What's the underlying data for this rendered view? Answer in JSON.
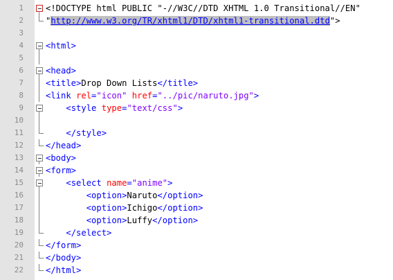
{
  "lines": [
    {
      "n": "1",
      "code": [
        {
          "c": "dt",
          "s": "<!DOCTYPE html PUBLIC \"-//W3C//DTD XHTML 1.0 Transitional//EN\""
        }
      ]
    },
    {
      "n": "2",
      "code": [
        {
          "c": "dt",
          "s": "\""
        },
        {
          "c": "url sel",
          "s": "http://www.w3.org/TR/xhtml1/DTD/xhtml1-transitional.dtd"
        },
        {
          "c": "dt",
          "s": "\">"
        }
      ]
    },
    {
      "n": "3",
      "code": []
    },
    {
      "n": "4",
      "code": [
        {
          "c": "t",
          "s": "<html>"
        }
      ]
    },
    {
      "n": "5",
      "code": []
    },
    {
      "n": "6",
      "code": [
        {
          "c": "t",
          "s": "<head>"
        }
      ]
    },
    {
      "n": "7",
      "code": [
        {
          "c": "t",
          "s": "<title>"
        },
        {
          "c": "x",
          "s": "Drop Down Lists"
        },
        {
          "c": "t",
          "s": "</title>"
        }
      ]
    },
    {
      "n": "8",
      "code": [
        {
          "c": "t",
          "s": "<link "
        },
        {
          "c": "a",
          "s": "rel"
        },
        {
          "c": "t",
          "s": "="
        },
        {
          "c": "v",
          "s": "\"icon\""
        },
        {
          "c": "t",
          "s": " "
        },
        {
          "c": "a",
          "s": "href"
        },
        {
          "c": "t",
          "s": "="
        },
        {
          "c": "v",
          "s": "\"../pic/naruto.jpg\""
        },
        {
          "c": "t",
          "s": ">"
        }
      ]
    },
    {
      "n": "9",
      "code": [
        {
          "c": "x",
          "s": "    "
        },
        {
          "c": "t",
          "s": "<style "
        },
        {
          "c": "a",
          "s": "type"
        },
        {
          "c": "t",
          "s": "="
        },
        {
          "c": "v",
          "s": "\"text/css\""
        },
        {
          "c": "t",
          "s": ">"
        }
      ]
    },
    {
      "n": "10",
      "code": []
    },
    {
      "n": "11",
      "code": [
        {
          "c": "x",
          "s": "    "
        },
        {
          "c": "t",
          "s": "</style>"
        }
      ]
    },
    {
      "n": "12",
      "code": [
        {
          "c": "t",
          "s": "</head>"
        }
      ]
    },
    {
      "n": "13",
      "code": [
        {
          "c": "t",
          "s": "<body>"
        }
      ]
    },
    {
      "n": "14",
      "code": [
        {
          "c": "t",
          "s": "<form>"
        }
      ]
    },
    {
      "n": "15",
      "code": [
        {
          "c": "x",
          "s": "    "
        },
        {
          "c": "t",
          "s": "<select "
        },
        {
          "c": "a",
          "s": "name"
        },
        {
          "c": "t",
          "s": "="
        },
        {
          "c": "v",
          "s": "\"anime\""
        },
        {
          "c": "t",
          "s": ">"
        }
      ]
    },
    {
      "n": "16",
      "code": [
        {
          "c": "x",
          "s": "        "
        },
        {
          "c": "t",
          "s": "<option>"
        },
        {
          "c": "x",
          "s": "Naruto"
        },
        {
          "c": "t",
          "s": "</option>"
        }
      ]
    },
    {
      "n": "17",
      "code": [
        {
          "c": "x",
          "s": "        "
        },
        {
          "c": "t",
          "s": "<option>"
        },
        {
          "c": "x",
          "s": "Ichigo"
        },
        {
          "c": "t",
          "s": "</option>"
        }
      ]
    },
    {
      "n": "18",
      "code": [
        {
          "c": "x",
          "s": "        "
        },
        {
          "c": "t",
          "s": "<option>"
        },
        {
          "c": "x",
          "s": "Luffy"
        },
        {
          "c": "t",
          "s": "</option>"
        }
      ]
    },
    {
      "n": "19",
      "code": [
        {
          "c": "x",
          "s": "    "
        },
        {
          "c": "t",
          "s": "</select>"
        }
      ]
    },
    {
      "n": "20",
      "code": [
        {
          "c": "t",
          "s": "</form>"
        }
      ]
    },
    {
      "n": "21",
      "code": [
        {
          "c": "t",
          "s": "</body>"
        }
      ]
    },
    {
      "n": "22",
      "code": [
        {
          "c": "t",
          "s": "</html>"
        }
      ]
    }
  ],
  "fold_markers": {
    "1": "box-red",
    "2": "corner",
    "4": "box",
    "5": "line",
    "6": "box",
    "7": "line",
    "8": "line",
    "9": "box",
    "10": "line",
    "11": "corner",
    "12": "corner",
    "13": "box",
    "14": "box",
    "15": "box",
    "16": "line",
    "17": "line",
    "18": "line",
    "19": "corner",
    "20": "corner",
    "21": "corner",
    "22": "corner"
  },
  "colors": {
    "tag": "#0000ff",
    "attr": "#ff0000",
    "value": "#8000ff",
    "text": "#000000",
    "gutter": "#e4e4e4",
    "line_number": "#8a8a8a",
    "selection": "#c0c0c0"
  }
}
